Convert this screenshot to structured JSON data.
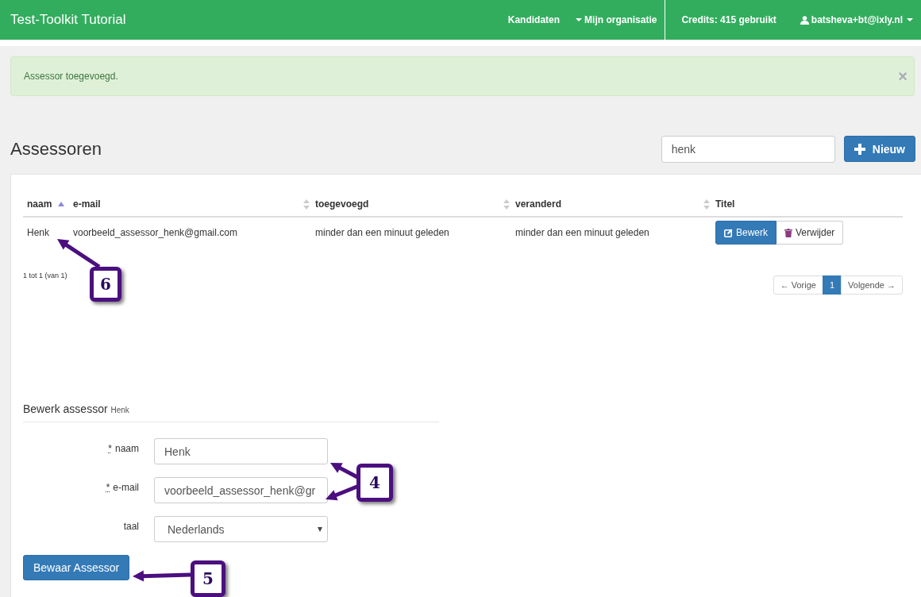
{
  "navbar": {
    "brand": "Test-Toolkit Tutorial",
    "items": [
      {
        "kind": "link",
        "label": "Kandidaten"
      },
      {
        "kind": "dropdown",
        "label": "Mijn organisatie"
      },
      {
        "kind": "text",
        "label": "Credits: 415 gebruikt"
      },
      {
        "kind": "user",
        "label": "batsheva+bt@ixly.nl"
      }
    ]
  },
  "alert": {
    "message": "Assessor toegevoegd.",
    "close": "×"
  },
  "page": {
    "title": "Assessoren",
    "search": {
      "value": "henk"
    },
    "new_button": "Nieuw"
  },
  "table": {
    "columns": [
      {
        "label": "naam",
        "kind": "sorted"
      },
      {
        "label": "e-mail",
        "kind": "sortable"
      },
      {
        "label": "toegevoegd",
        "kind": "sortable"
      },
      {
        "label": "veranderd",
        "kind": "sortable"
      },
      {
        "label": "Titel",
        "kind": "plain"
      }
    ],
    "rows": [
      {
        "naam": "Henk",
        "email": "voorbeeld_assessor_henk@gmail.com",
        "toegevoegd": "minder dan een minuut geleden",
        "veranderd": "minder dan een minuut geleden",
        "actions": [
          "Bewerk",
          "Verwijder"
        ]
      }
    ]
  },
  "pagination": {
    "info": "1 tot 1 (van 1)",
    "previous": "← Vorige",
    "pages": [
      {
        "label": "1",
        "selected": true
      }
    ],
    "next": "Volgende →"
  },
  "form": {
    "heading": "Bewerk assessor",
    "heading_name": "Henk",
    "fields": [
      {
        "kind": "input",
        "label": "naam",
        "required_mark": "*",
        "value": "Henk"
      },
      {
        "kind": "input",
        "label": "e-mail",
        "required_mark": "*",
        "value": "voorbeeld_assessor_henk@gr"
      },
      {
        "kind": "select",
        "label": "taal",
        "value": "Nederlands"
      }
    ],
    "submit": "Bewaar Assessor"
  },
  "callouts": [
    {
      "label": "6"
    },
    {
      "label": "4"
    },
    {
      "label": "5"
    }
  ]
}
